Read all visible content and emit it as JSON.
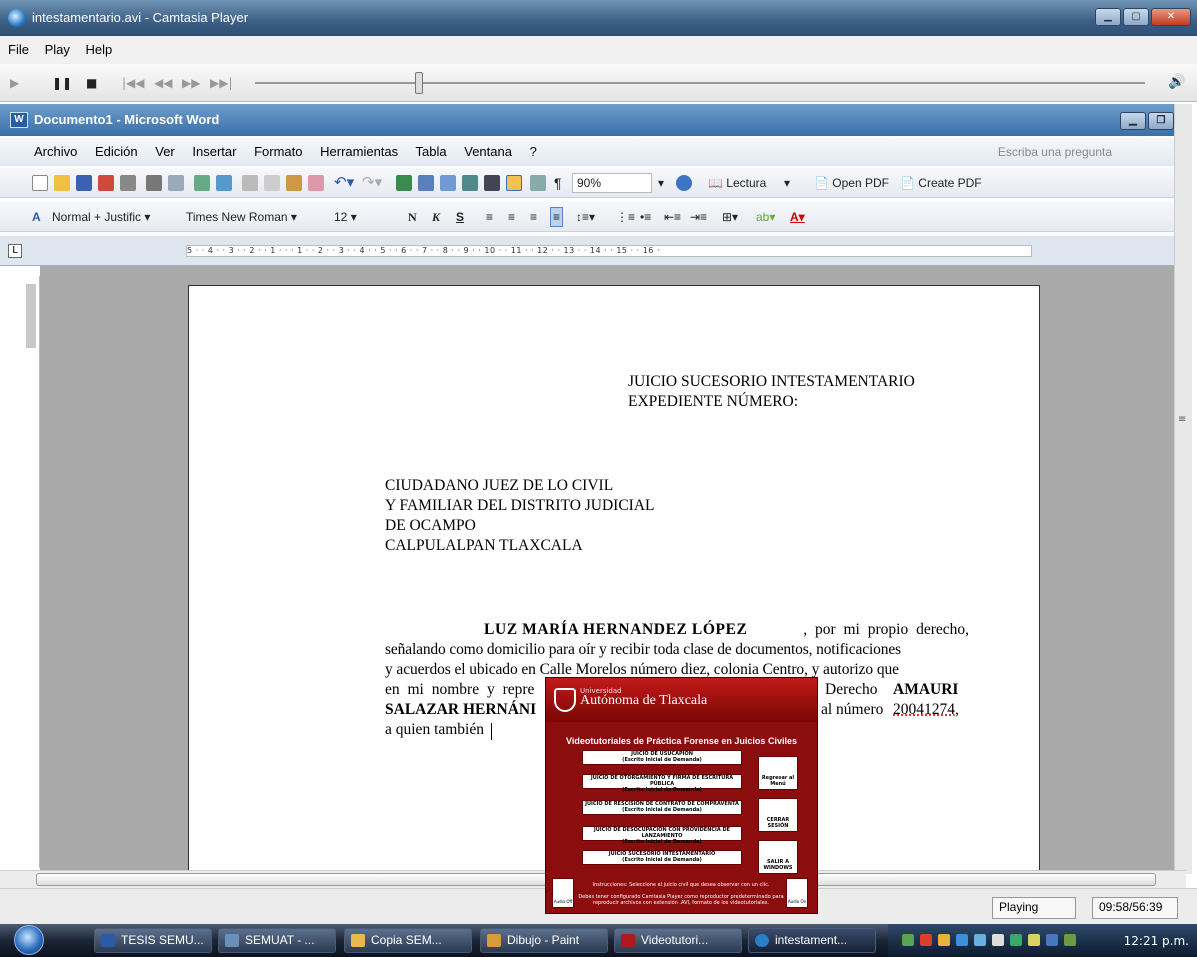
{
  "player": {
    "title": "intestamentario.avi - Camtasia Player",
    "menu": [
      "File",
      "Play",
      "Help"
    ],
    "status": "Playing",
    "time": "09:58/56:39"
  },
  "word": {
    "title": "Documento1 - Microsoft Word",
    "menu": [
      "Archivo",
      "Edición",
      "Ver",
      "Insertar",
      "Formato",
      "Herramientas",
      "Tabla",
      "Ventana",
      "?"
    ],
    "ask_placeholder": "Escriba una pregunta",
    "zoom": "90%",
    "lectura": "Lectura",
    "open_pdf": "Open PDF",
    "create_pdf": "Create PDF",
    "style": "Normal + Justific",
    "font": "Times New Roman",
    "font_size": "12",
    "bold_label": "N",
    "italic_label": "K",
    "underline_label": "S",
    "ruler_text": "5 · · 4 · · 3 · · 2 · · 1 · · · 1 · · 2 · · 3 · · 4 · · 5 · · 6 · · 7 · · 8 · · 9 · · 10 · · 11 · · 12 · · 13 · · 14 · · 15 · · 16 ·"
  },
  "document": {
    "heading1": "JUICIO SUCESORIO INTESTAMENTARIO",
    "heading2": "EXPEDIENTE NÚMERO:",
    "address1": "CIUDADANO JUEZ DE LO CIVIL",
    "address2": "Y FAMILIAR DEL DISTRITO JUDICIAL",
    "address3": "DE OCAMPO",
    "address4": "CALPULALPAN TLAXCALA",
    "name": "LUZ MARÍA HERNANDEZ LÓPEZ",
    "line1_rest": ", por mi propio derecho,",
    "line2": "señalando como domicilio para oír y recibir toda clase de documentos, notificaciones",
    "line3": "y acuerdos el ubicado en Calle Morelos número diez, colonia Centro, y autorizo que",
    "line4a": "en mi nombre y repre",
    "line4b": "Derecho",
    "line4c": "AMAURI",
    "line5a": "SALAZAR HERNÁNI",
    "line5b": "al número",
    "line5c": "20041274,",
    "line6": "a quien también"
  },
  "overlay": {
    "univ_small": "Universidad",
    "univ_name": "Autónoma de Tlaxcala",
    "heading": "Videotutoriales de Práctica Forense en Juicios Civiles",
    "buttons": [
      {
        "title": "JUICIO DE USUCAPIÓN",
        "sub": "(Escrito Inicial de Demanda)"
      },
      {
        "title": "JUICIO DE OTORGAMIENTO Y FIRMA DE ESCRITURA PÚBLICA",
        "sub": "(Escrito Inicial de Demanda)"
      },
      {
        "title": "JUICIO DE RESCISIÓN DE CONTRATO DE COMPRAVENTA",
        "sub": "(Escrito Inicial de Demanda)"
      },
      {
        "title": "JUICIO DE DESOCUPACIÓN CON PROVIDENCIA DE LANZAMIENTO",
        "sub": "(Escrito Inicial de Demanda)"
      },
      {
        "title": "JUICIO SUCESORIO INTESTAMENTARIO",
        "sub": "(Escrito Inicial de Demanda)"
      }
    ],
    "side": [
      "Regresar al Menú",
      "CERRAR SESIÓN",
      "SALIR A WINDOWS"
    ],
    "instructions": "Instrucciones: Seleccione el juicio civil que desea observar con un clic.",
    "note": "Debes tener configurado Camtasia Player como reproductor predeterminado para reproducir archivos con extensión .AVI, formato de los videotutoriales.",
    "audio_off": "Audio Off",
    "audio_on": "Audio On"
  },
  "taskbar": {
    "items": [
      "TESIS SEMU...",
      "SEMUAT - ...",
      "Copia SEM...",
      "Dibujo - Paint",
      "Videotutori...",
      "intestament..."
    ],
    "clock": "12:21 p.m."
  }
}
